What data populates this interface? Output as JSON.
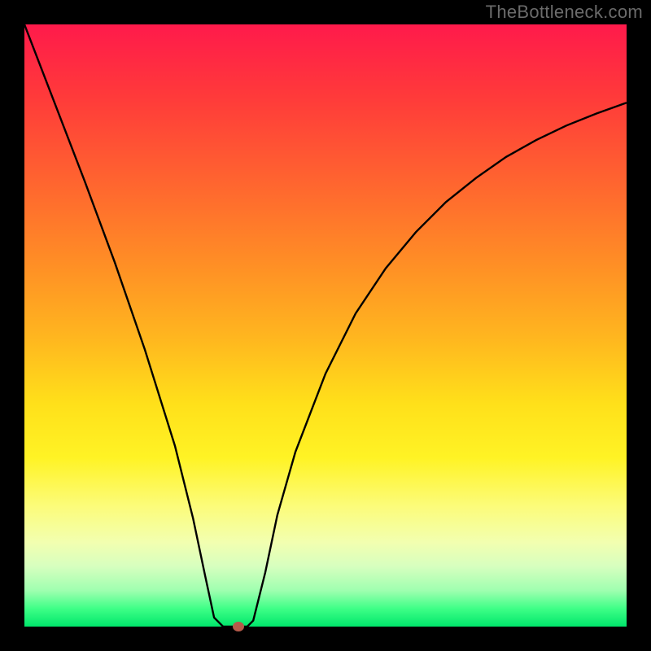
{
  "watermark": "TheBottleneck.com",
  "chart_data": {
    "type": "line",
    "title": "",
    "xlabel": "",
    "ylabel": "",
    "xlim": [
      0,
      1
    ],
    "ylim": [
      0,
      1
    ],
    "series": [
      {
        "name": "curve",
        "x": [
          0.0,
          0.05,
          0.1,
          0.15,
          0.2,
          0.25,
          0.28,
          0.3,
          0.315,
          0.33,
          0.37,
          0.38,
          0.4,
          0.42,
          0.45,
          0.5,
          0.55,
          0.6,
          0.65,
          0.7,
          0.75,
          0.8,
          0.85,
          0.9,
          0.95,
          1.0
        ],
        "values": [
          1.0,
          0.87,
          0.74,
          0.605,
          0.46,
          0.3,
          0.18,
          0.085,
          0.015,
          0.0,
          0.0,
          0.01,
          0.09,
          0.185,
          0.29,
          0.42,
          0.52,
          0.595,
          0.655,
          0.705,
          0.745,
          0.78,
          0.808,
          0.832,
          0.852,
          0.87
        ]
      }
    ],
    "marker": {
      "x": 0.355,
      "y": 0.0,
      "color": "#b55a4a"
    },
    "background_gradient": {
      "top": "#ff1a4b",
      "middle": "#ffe01a",
      "bottom": "#00e66b"
    }
  }
}
